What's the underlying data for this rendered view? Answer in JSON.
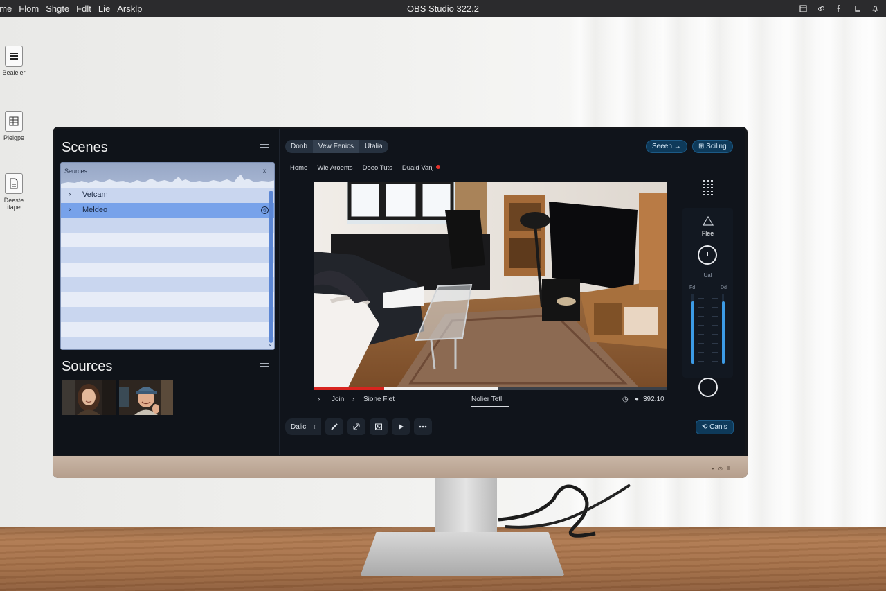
{
  "menubar": {
    "menu": [
      "ome",
      "Flom",
      "Shgte",
      "Fdlt",
      "Lie",
      "Arsklp"
    ],
    "title": "OBS Studio 322.2",
    "tray_icons": [
      "window-icon",
      "link-icon",
      "f-icon",
      "lock-icon",
      "bell-icon"
    ]
  },
  "desktop": {
    "icons": [
      {
        "label": "Beaieler",
        "icon": "document-icon"
      },
      {
        "label": "Pielgpe",
        "icon": "spreadsheet-icon"
      },
      {
        "label": "Deeste itape",
        "icon": "file-icon"
      }
    ]
  },
  "scenes": {
    "title": "Scenes",
    "header_label": "Seurces",
    "header_close": "x",
    "items": [
      {
        "name": "Vetcam",
        "selected": false
      },
      {
        "name": "Meldeo",
        "selected": true
      },
      {
        "name": "",
        "selected": false
      },
      {
        "name": "",
        "selected": false
      },
      {
        "name": "",
        "selected": false
      },
      {
        "name": "",
        "selected": false
      },
      {
        "name": "",
        "selected": false
      },
      {
        "name": "",
        "selected": false
      },
      {
        "name": "",
        "selected": false
      },
      {
        "name": "",
        "selected": false
      },
      {
        "name": "",
        "selected": false
      }
    ]
  },
  "sources": {
    "title": "Sources",
    "thumbnails": [
      "webcam-woman",
      "webcam-man-cap"
    ]
  },
  "toolbar": {
    "pills": [
      "Donb",
      "Vew Fenics",
      "Utalia"
    ],
    "seen_button": "Seeen",
    "seen_arrow": "→",
    "settings_button": "Sciling"
  },
  "breadcrumbs": [
    "Home",
    "Wie Aroents",
    "Doeo Tuts",
    "Duald Vanj"
  ],
  "preview": {
    "progress_red": 0.2,
    "progress_white_end": 0.52
  },
  "transport": {
    "item1": "Join",
    "item2": "Sione Flet",
    "center": "Nolier Tetl",
    "time": "392.10"
  },
  "bottom_bar": {
    "first": "Dalic",
    "buttons": [
      "back-icon",
      "pen-icon",
      "link-icon",
      "image-icon",
      "play-icon",
      "more-icon"
    ],
    "right_button": "Canis"
  },
  "side": {
    "label1": "Flee",
    "label2": "Ual",
    "mix_left": "Fd",
    "mix_right": "Dd",
    "slider_left_level": 0.9,
    "slider_right_level": 0.9
  },
  "colors": {
    "accent": "#3c9be6",
    "selection": "#77a2ea",
    "record": "#e2332c"
  }
}
